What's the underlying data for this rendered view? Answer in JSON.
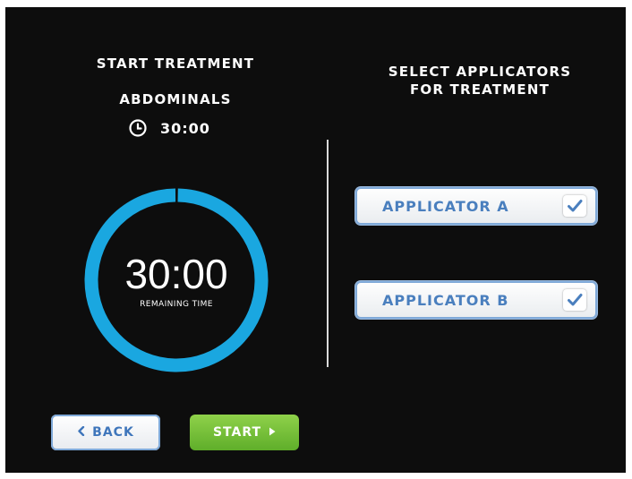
{
  "left": {
    "title": "START TREATMENT",
    "area": "ABDOMINALS",
    "duration": "30:00",
    "timer": {
      "value": "30:00",
      "label": "REMAINING TIME",
      "progress_fraction": 1.0,
      "ring_color": "#1aa7e0"
    }
  },
  "right": {
    "title_line1": "SELECT APPLICATORS",
    "title_line2": "FOR TREATMENT",
    "applicators": [
      {
        "label": "APPLICATOR A",
        "checked": true
      },
      {
        "label": "APPLICATOR B",
        "checked": true
      }
    ]
  },
  "buttons": {
    "back_label": "BACK",
    "start_label": "START"
  },
  "icons": {
    "clock": "clock-icon",
    "back": "chevron-left-icon",
    "start": "triangle-right-icon",
    "check": "checkmark-icon"
  },
  "colors": {
    "background": "#0d0d0d",
    "accent_blue": "#4a7fbe",
    "start_green": "#6bbd33"
  }
}
